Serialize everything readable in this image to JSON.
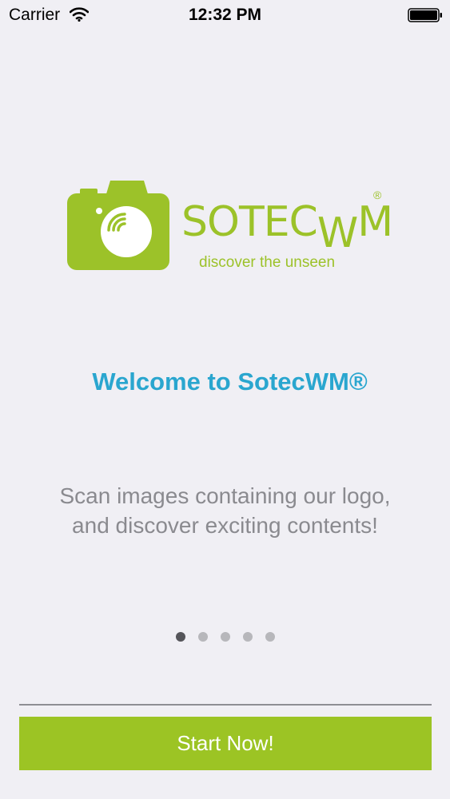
{
  "status_bar": {
    "carrier": "Carrier",
    "time": "12:32 PM",
    "wifi_icon": "wifi-icon",
    "battery_icon": "battery-full-icon"
  },
  "logo": {
    "wordmark_sote": "SOTEC",
    "wordmark_w": "W",
    "wordmark_m": "M",
    "registered": "®",
    "tagline": "discover the unseen",
    "camera_icon": "camera-icon",
    "brand_color": "#9cc229"
  },
  "welcome": {
    "title": "Welcome to SotecWM®",
    "title_color": "#2aa6cf"
  },
  "description": {
    "line1": "Scan images containing our logo,",
    "line2": "and discover exciting contents!"
  },
  "pager": {
    "total_pages": 5,
    "current_page": 1
  },
  "actions": {
    "start_label": "Start Now!",
    "button_color": "#9cc424"
  }
}
